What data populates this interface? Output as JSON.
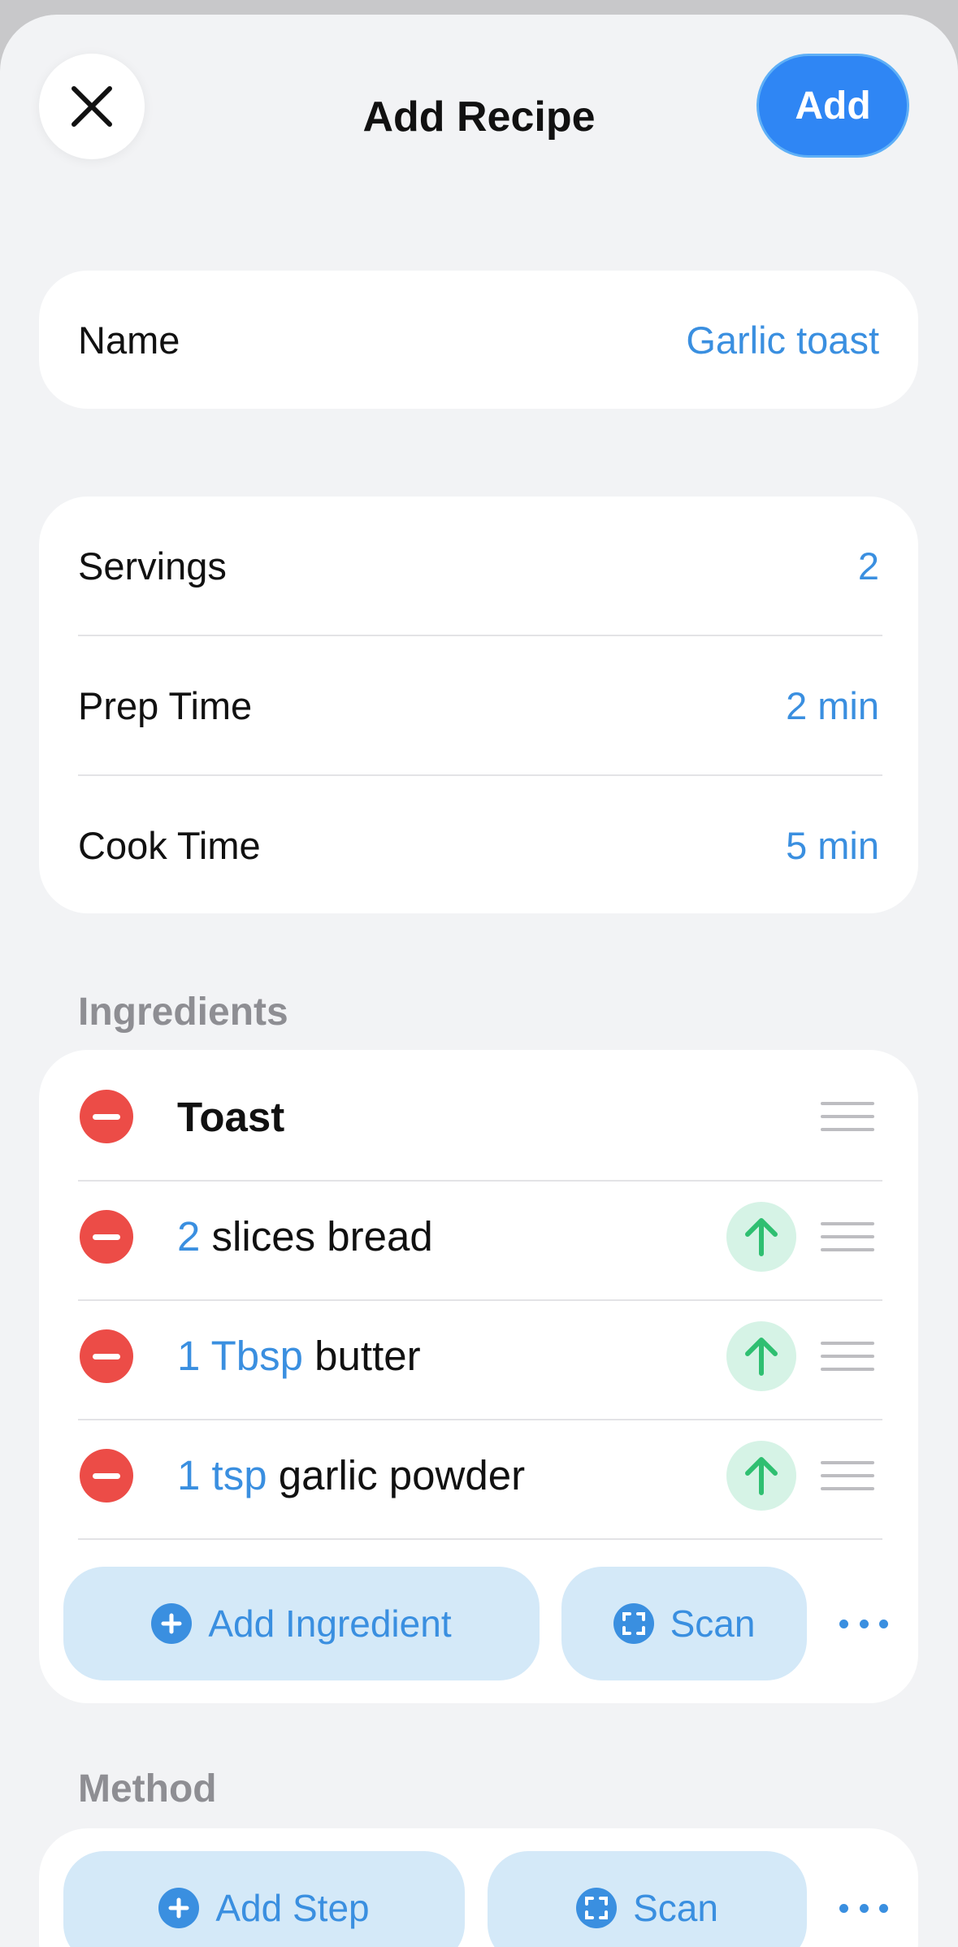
{
  "header": {
    "title": "Add Recipe",
    "add_label": "Add",
    "close_icon": "close-icon"
  },
  "name_card": {
    "label": "Name",
    "value": "Garlic toast"
  },
  "details": [
    {
      "label": "Servings",
      "value": "2"
    },
    {
      "label": "Prep Time",
      "value": "2 min"
    },
    {
      "label": "Cook Time",
      "value": "5 min"
    }
  ],
  "ingredients": {
    "section_label": "Ingredients",
    "group": {
      "title": "Toast"
    },
    "items": [
      {
        "quantity": "2",
        "name": "slices bread"
      },
      {
        "quantity": "1 Tbsp",
        "name": "butter"
      },
      {
        "quantity": "1 tsp",
        "name": "garlic powder"
      }
    ],
    "add_label": "Add Ingredient",
    "scan_label": "Scan"
  },
  "method": {
    "section_label": "Method",
    "add_label": "Add Step",
    "scan_label": "Scan"
  },
  "colors": {
    "accent": "#3a8fe0",
    "add_button": "#2f86f4",
    "delete": "#ec4c47",
    "move_up": "#2fbf71",
    "pill_bg": "#d4e9f8"
  }
}
